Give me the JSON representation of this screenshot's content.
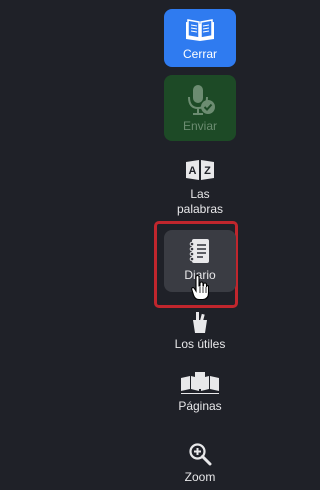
{
  "toolbar": {
    "close": {
      "label": "Cerrar",
      "icon": "open-book-icon"
    },
    "send": {
      "label": "Enviar",
      "icon": "microphone-check-icon"
    },
    "words": {
      "label_line1": "Las",
      "label_line2": "palabras",
      "icon": "az-dictionary-icon"
    },
    "diary": {
      "label": "Diario",
      "icon": "notebook-icon"
    },
    "tools": {
      "label": "Los útiles",
      "icon": "pencil-cup-icon"
    },
    "pages": {
      "label": "Páginas",
      "icon": "pages-icon"
    },
    "zoom": {
      "label": "Zoom",
      "icon": "zoom-in-icon"
    }
  },
  "colors": {
    "background": "#1f2128",
    "close_button": "#2f7bf0",
    "send_button": "#1d4a26",
    "diary_button": "#3a3c43",
    "highlight": "#c0262d"
  }
}
